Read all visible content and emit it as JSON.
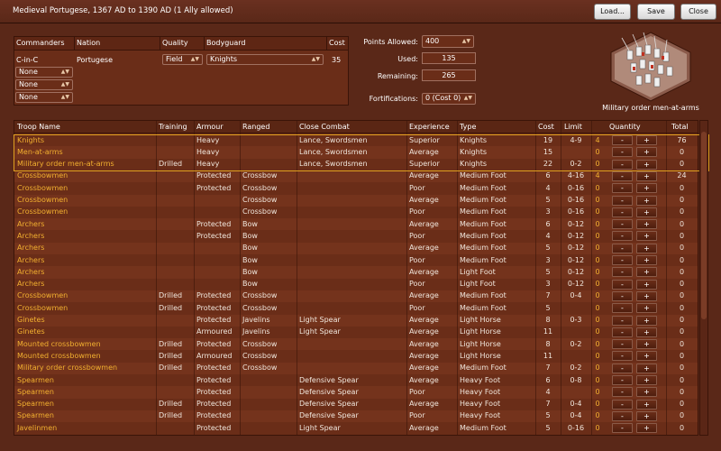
{
  "window": {
    "title": "Medieval Portugese, 1367 AD to 1390 AD (1 Ally allowed)",
    "buttons": {
      "load": "Load...",
      "save": "Save",
      "close": "Close"
    }
  },
  "commanders": {
    "headers": [
      "Commanders",
      "Nation",
      "Quality",
      "Bodyguard",
      "Cost"
    ],
    "rows": [
      {
        "commander": "C-in-C",
        "nation": "Portugese",
        "quality": "Field",
        "bodyguard": "Knights",
        "cost": "35"
      }
    ],
    "empty_slots": [
      "None",
      "None",
      "None"
    ]
  },
  "points": {
    "allowed_label": "Points Allowed:",
    "allowed_value": "400",
    "used_label": "Used:",
    "used_value": "135",
    "remaining_label": "Remaining:",
    "remaining_value": "265",
    "fort_label": "Fortifications:",
    "fort_value": "0 (Cost 0)"
  },
  "selected_unit": {
    "caption": "Military order men-at-arms"
  },
  "troops": {
    "headers": {
      "name": "Troop Name",
      "training": "Training",
      "armour": "Armour",
      "ranged": "Ranged",
      "close": "Close Combat",
      "experience": "Experience",
      "type": "Type",
      "cost": "Cost",
      "limit": "Limit",
      "quantity": "Quantity",
      "total": "Total"
    },
    "qty_minus": "-",
    "qty_plus": "+",
    "rows": [
      [
        "Knights",
        "",
        "Heavy",
        "",
        "Lance, Swordsmen",
        "Superior",
        "Knights",
        "19",
        "4-9",
        "4",
        "76"
      ],
      [
        "Men-at-arms",
        "",
        "Heavy",
        "",
        "Lance, Swordsmen",
        "Average",
        "Knights",
        "15",
        "",
        "0",
        "0"
      ],
      [
        "Military order men-at-arms",
        "Drilled",
        "Heavy",
        "",
        "Lance, Swordsmen",
        "Superior",
        "Knights",
        "22",
        "0-2",
        "0",
        "0"
      ],
      [
        "Crossbowmen",
        "",
        "Protected",
        "Crossbow",
        "",
        "Average",
        "Medium Foot",
        "6",
        "4-16",
        "4",
        "24"
      ],
      [
        "Crossbowmen",
        "",
        "Protected",
        "Crossbow",
        "",
        "Poor",
        "Medium Foot",
        "4",
        "0-16",
        "0",
        "0"
      ],
      [
        "Crossbowmen",
        "",
        "",
        "Crossbow",
        "",
        "Average",
        "Medium Foot",
        "5",
        "0-16",
        "0",
        "0"
      ],
      [
        "Crossbowmen",
        "",
        "",
        "Crossbow",
        "",
        "Poor",
        "Medium Foot",
        "3",
        "0-16",
        "0",
        "0"
      ],
      [
        "Archers",
        "",
        "Protected",
        "Bow",
        "",
        "Average",
        "Medium Foot",
        "6",
        "0-12",
        "0",
        "0"
      ],
      [
        "Archers",
        "",
        "Protected",
        "Bow",
        "",
        "Poor",
        "Medium Foot",
        "4",
        "0-12",
        "0",
        "0"
      ],
      [
        "Archers",
        "",
        "",
        "Bow",
        "",
        "Average",
        "Medium Foot",
        "5",
        "0-12",
        "0",
        "0"
      ],
      [
        "Archers",
        "",
        "",
        "Bow",
        "",
        "Poor",
        "Medium Foot",
        "3",
        "0-12",
        "0",
        "0"
      ],
      [
        "Archers",
        "",
        "",
        "Bow",
        "",
        "Average",
        "Light Foot",
        "5",
        "0-12",
        "0",
        "0"
      ],
      [
        "Archers",
        "",
        "",
        "Bow",
        "",
        "Poor",
        "Light Foot",
        "3",
        "0-12",
        "0",
        "0"
      ],
      [
        "Crossbowmen",
        "Drilled",
        "Protected",
        "Crossbow",
        "",
        "Average",
        "Medium Foot",
        "7",
        "0-4",
        "0",
        "0"
      ],
      [
        "Crossbowmen",
        "Drilled",
        "Protected",
        "Crossbow",
        "",
        "Poor",
        "Medium Foot",
        "5",
        "",
        "0",
        "0"
      ],
      [
        "Ginetes",
        "",
        "Protected",
        "Javelins",
        "Light Spear",
        "Average",
        "Light Horse",
        "8",
        "0-3",
        "0",
        "0"
      ],
      [
        "Ginetes",
        "",
        "Armoured",
        "Javelins",
        "Light Spear",
        "Average",
        "Light Horse",
        "11",
        "",
        "0",
        "0"
      ],
      [
        "Mounted crossbowmen",
        "Drilled",
        "Protected",
        "Crossbow",
        "",
        "Average",
        "Light Horse",
        "8",
        "0-2",
        "0",
        "0"
      ],
      [
        "Mounted crossbowmen",
        "Drilled",
        "Armoured",
        "Crossbow",
        "",
        "Average",
        "Light Horse",
        "11",
        "",
        "0",
        "0"
      ],
      [
        "Military order crossbowmen",
        "Drilled",
        "Protected",
        "Crossbow",
        "",
        "Average",
        "Medium Foot",
        "7",
        "0-2",
        "0",
        "0"
      ],
      [
        "Spearmen",
        "",
        "Protected",
        "",
        "Defensive Spear",
        "Average",
        "Heavy Foot",
        "6",
        "0-8",
        "0",
        "0"
      ],
      [
        "Spearmen",
        "",
        "Protected",
        "",
        "Defensive Spear",
        "Poor",
        "Heavy Foot",
        "4",
        "",
        "0",
        "0"
      ],
      [
        "Spearmen",
        "Drilled",
        "Protected",
        "",
        "Defensive Spear",
        "Average",
        "Heavy Foot",
        "7",
        "0-4",
        "0",
        "0"
      ],
      [
        "Spearmen",
        "Drilled",
        "Protected",
        "",
        "Defensive Spear",
        "Poor",
        "Heavy Foot",
        "5",
        "0-4",
        "0",
        "0"
      ],
      [
        "Javelinmen",
        "",
        "Protected",
        "",
        "Light Spear",
        "Average",
        "Medium Foot",
        "5",
        "0-16",
        "0",
        "0"
      ]
    ]
  },
  "colors": {
    "background": "#5a2818",
    "troop_name": "#f2b030",
    "highlight": "#e0a020"
  }
}
